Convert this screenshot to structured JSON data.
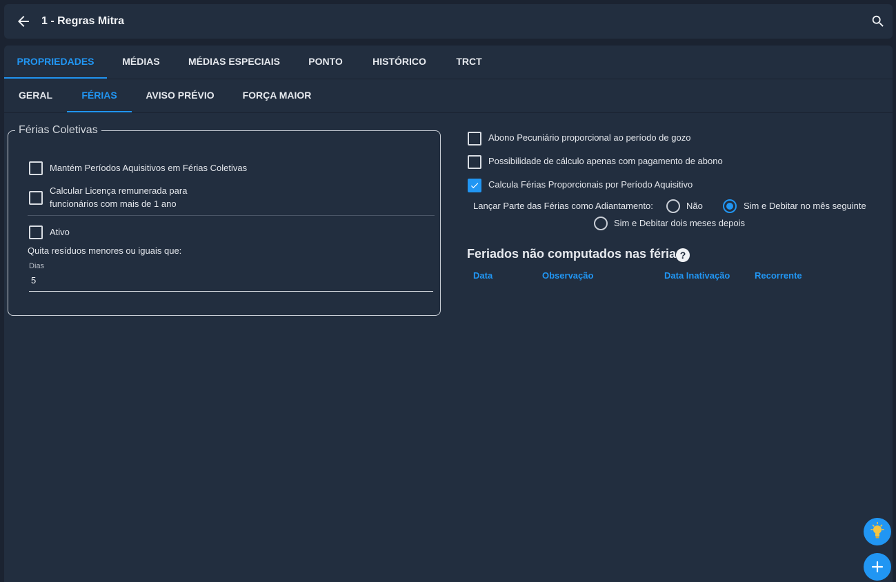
{
  "header": {
    "title": "1 - Regras Mitra"
  },
  "tabs_main": [
    {
      "label": "PROPRIEDADES",
      "active": true
    },
    {
      "label": "MÉDIAS",
      "active": false
    },
    {
      "label": "MÉDIAS ESPECIAIS",
      "active": false
    },
    {
      "label": "PONTO",
      "active": false
    },
    {
      "label": "HISTÓRICO",
      "active": false
    },
    {
      "label": "TRCT",
      "active": false
    }
  ],
  "tabs_sub": [
    {
      "label": "GERAL",
      "active": false
    },
    {
      "label": "FÉRIAS",
      "active": true
    },
    {
      "label": "AVISO PRÉVIO",
      "active": false
    },
    {
      "label": "FORÇA MAIOR",
      "active": false
    }
  ],
  "ferias_coletivas": {
    "legend": "Férias Coletivas",
    "mantem_periodos": {
      "label": "Mantém Períodos Aquisitivos em Férias Coletivas",
      "checked": false
    },
    "calcular_licenca": {
      "label_line1": "Calcular Licença remunerada para",
      "label_line2": "funcionários com mais de 1 ano",
      "checked": false
    },
    "ativo": {
      "label": "Ativo",
      "checked": false
    },
    "quita_residuos": "Quita resíduos menores ou iguais que:",
    "dias_label": "Dias",
    "dias_value": "5"
  },
  "options": {
    "abono": {
      "label": "Abono Pecuniário proporcional ao período de gozo",
      "checked": false
    },
    "possibilidade": {
      "label": "Possibilidade de cálculo apenas com pagamento de abono",
      "checked": false
    },
    "calcula_ferias": {
      "label": "Calcula Férias Proporcionais por Período Aquisitivo",
      "checked": true
    }
  },
  "adiantamento": {
    "label": "Lançar Parte das Férias como Adiantamento:",
    "options": [
      {
        "label": "Não",
        "checked": false
      },
      {
        "label": "Sim e Debitar no mês seguinte",
        "checked": true
      },
      {
        "label": "Sim e Debitar dois meses depois",
        "checked": false
      }
    ]
  },
  "feriados": {
    "title": "Feriados não computados nas férias",
    "help": "?",
    "columns": [
      "Data",
      "Observação",
      "Data Inativação",
      "Recorrente"
    ]
  },
  "colors": {
    "accent": "#2196f3",
    "background": "#1b2331",
    "surface": "#222e3f"
  },
  "icons": [
    "arrow-left-icon",
    "search-icon",
    "check-icon",
    "help-icon",
    "lightbulb-icon",
    "plus-icon"
  ]
}
